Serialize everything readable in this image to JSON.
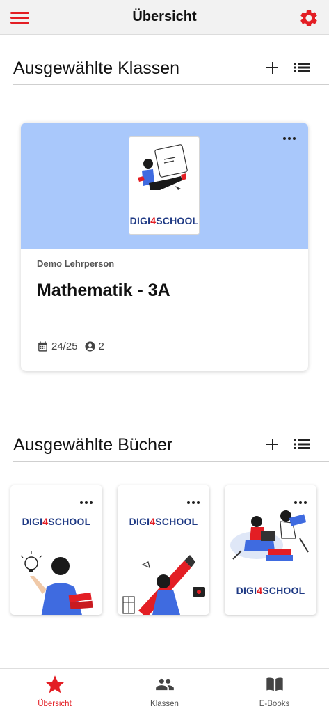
{
  "header": {
    "title": "Übersicht",
    "menu_icon": "hamburger-menu-icon",
    "settings_icon": "gear-icon",
    "accent": "#e31e24"
  },
  "classes_section": {
    "title": "Ausgewählte Klassen",
    "add_icon": "plus-icon",
    "list_icon": "list-icon"
  },
  "class_card": {
    "teacher": "Demo Lehrperson",
    "name": "Mathematik - 3A",
    "cover_brand": {
      "prefix": "DIGI",
      "digit": "4",
      "suffix": "SCHOOL"
    },
    "date": "24/25",
    "members": "2",
    "header_color": "#a9c8fb"
  },
  "books_section": {
    "title": "Ausgewählte Bücher",
    "add_icon": "plus-icon",
    "list_icon": "list-icon"
  },
  "books": [
    {
      "brand": {
        "prefix": "DIGI",
        "digit": "4",
        "suffix": "SCHOOL"
      }
    },
    {
      "brand": {
        "prefix": "DIGI",
        "digit": "4",
        "suffix": "SCHOOL"
      }
    },
    {
      "brand": {
        "prefix": "DIGI",
        "digit": "4",
        "suffix": "SCHOOL"
      }
    }
  ],
  "bottom_nav": {
    "items": [
      {
        "label": "Übersicht",
        "icon": "star-icon",
        "active": true
      },
      {
        "label": "Klassen",
        "icon": "group-icon",
        "active": false
      },
      {
        "label": "E-Books",
        "icon": "book-icon",
        "active": false
      }
    ]
  }
}
